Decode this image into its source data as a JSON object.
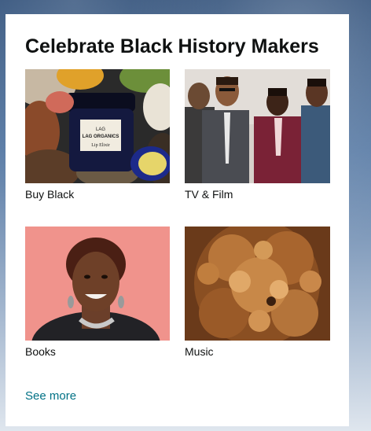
{
  "card": {
    "title": "Celebrate Black History Makers",
    "see_more_label": "See more"
  },
  "tiles": [
    {
      "label": "Buy Black"
    },
    {
      "label": "TV & Film"
    },
    {
      "label": "Books"
    },
    {
      "label": "Music"
    }
  ],
  "product_jar": {
    "brand_line": "LAG ORGANICS",
    "sub_line": "Lip Elixir"
  },
  "colors": {
    "title_text": "#0f1111",
    "link": "#007185",
    "card_bg": "#ffffff"
  }
}
